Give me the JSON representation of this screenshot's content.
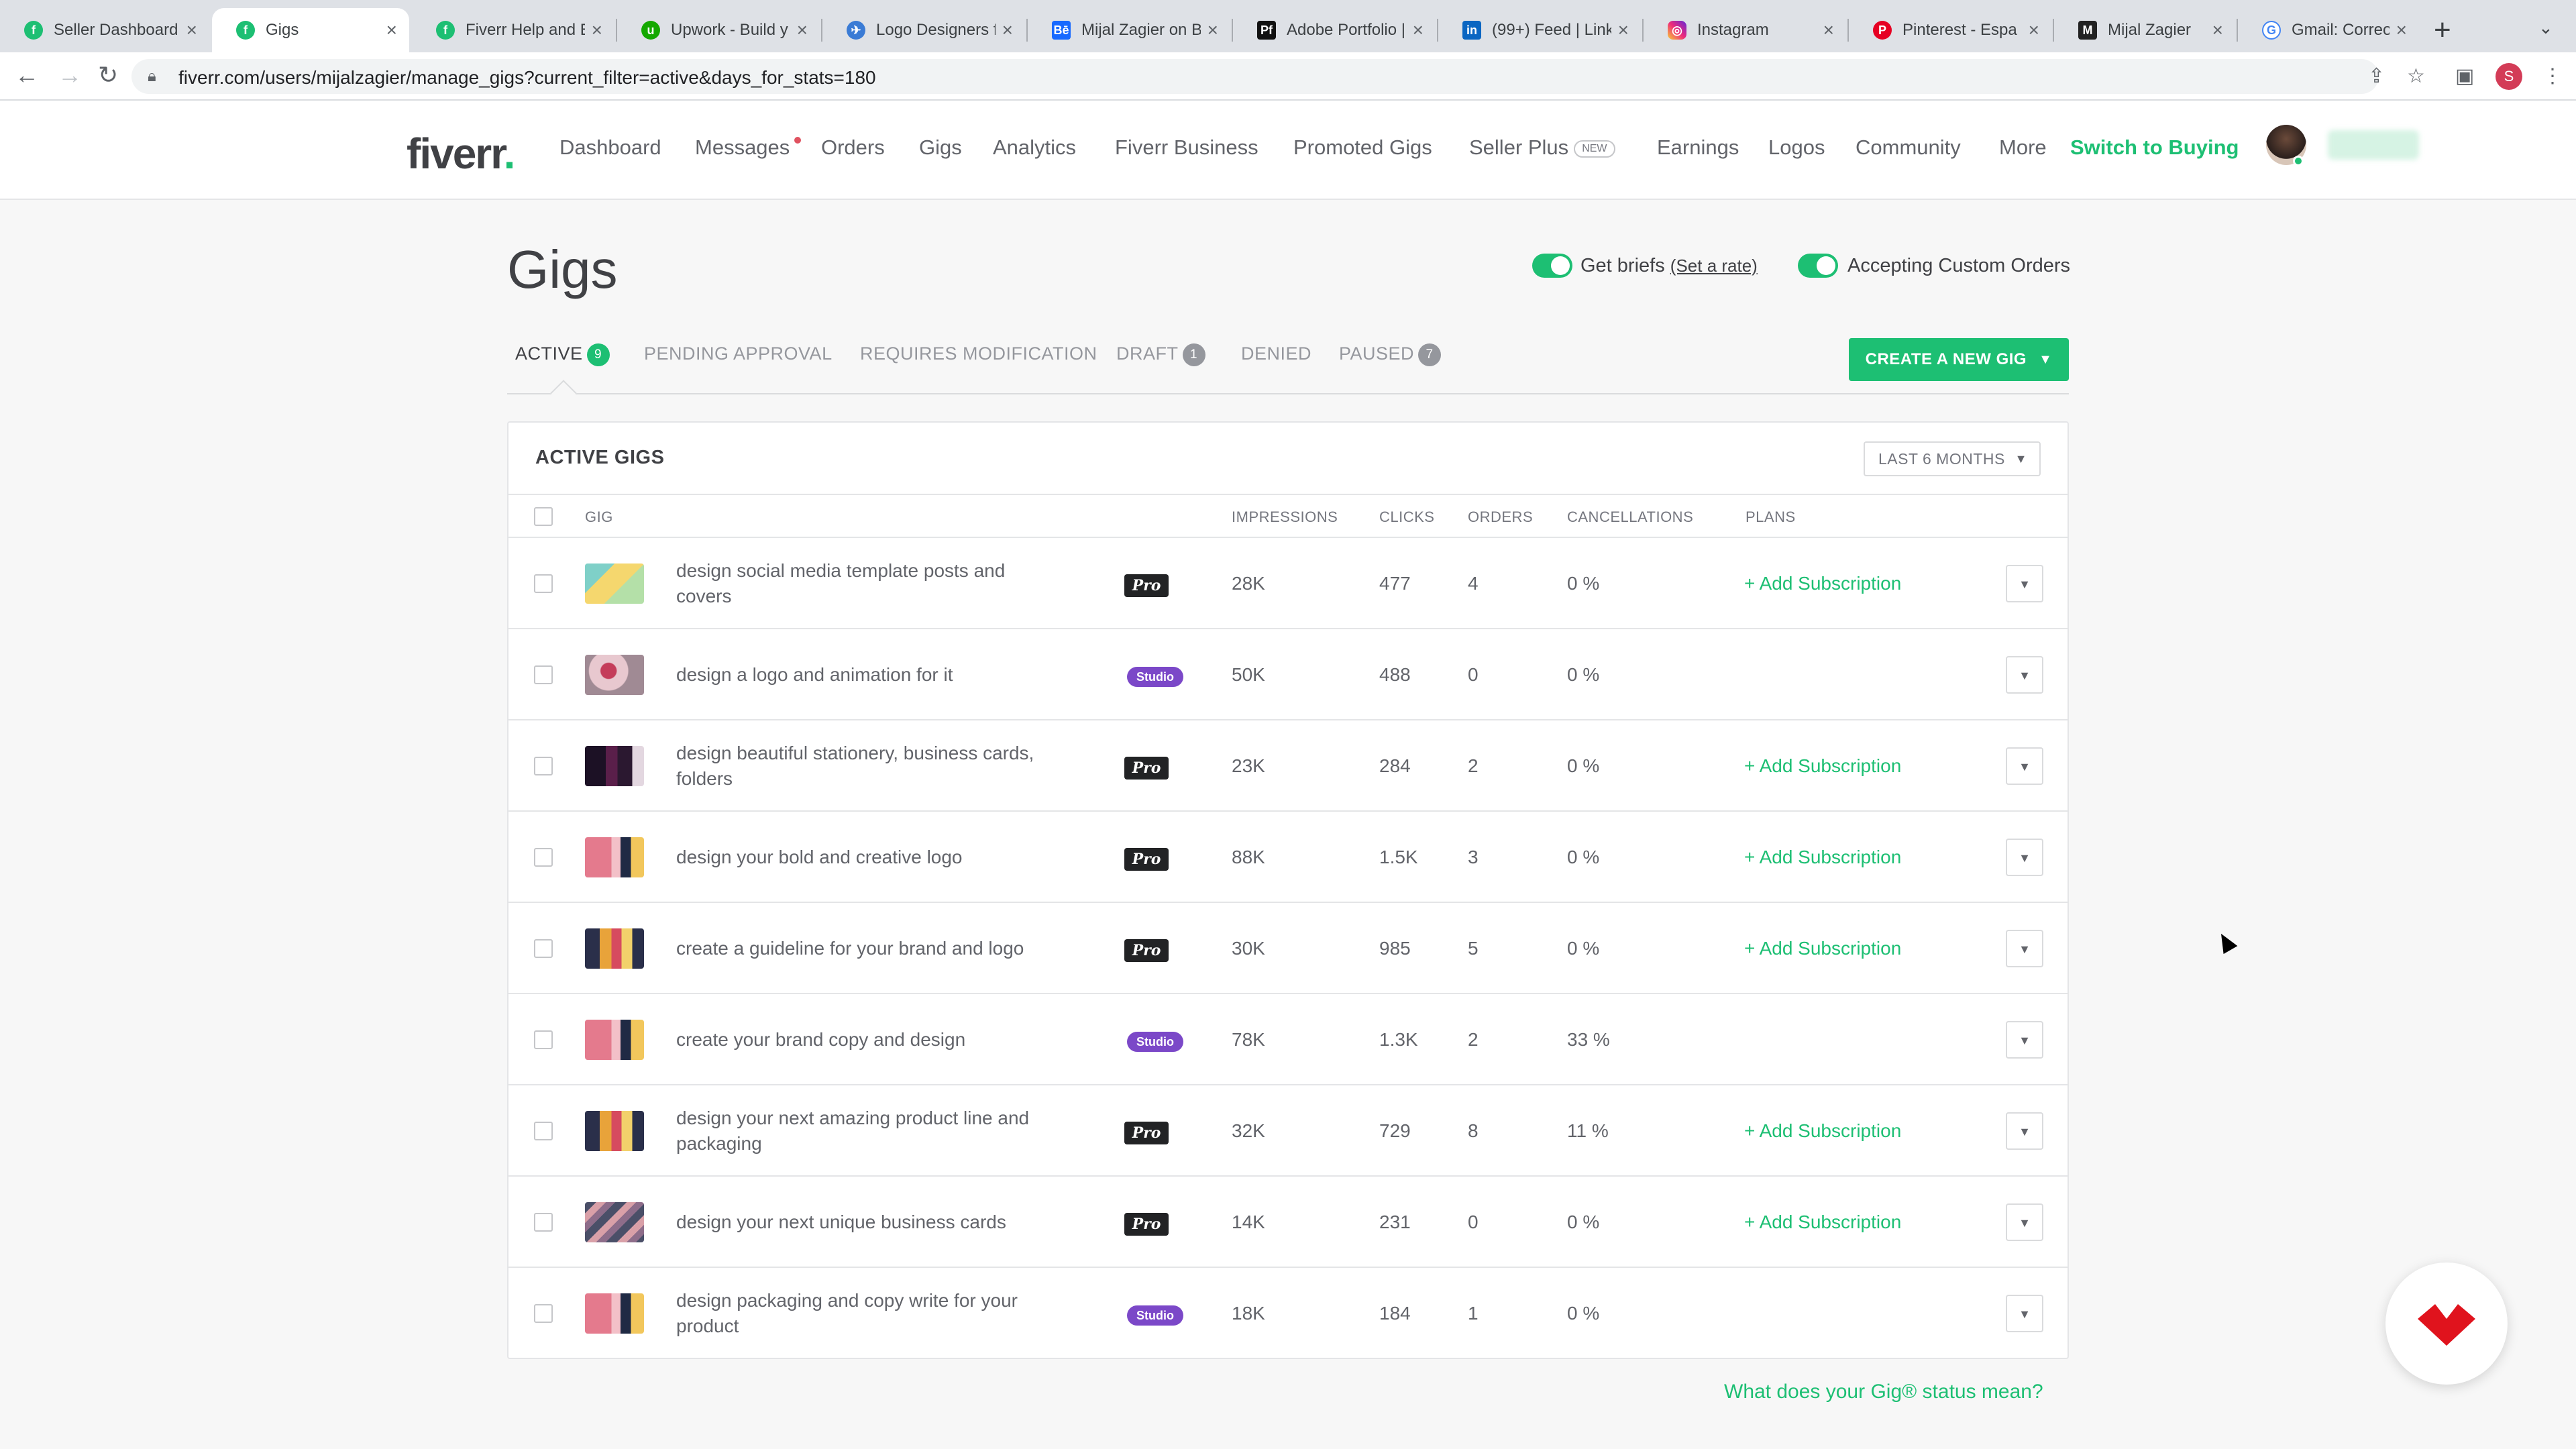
{
  "browser": {
    "tabs": [
      {
        "title": "Seller Dashboard",
        "icon": "fiverr-favicon",
        "color": "#1dbf73"
      },
      {
        "title": "Gigs",
        "icon": "fiverr-favicon",
        "color": "#1dbf73",
        "active": true
      },
      {
        "title": "Fiverr Help and E",
        "icon": "fiverr-favicon",
        "color": "#1dbf73"
      },
      {
        "title": "Upwork - Build y",
        "icon": "upwork-favicon",
        "color": "#14a800"
      },
      {
        "title": "Logo Designers f",
        "icon": "logo-designers-favicon",
        "color": "#3a7bd5"
      },
      {
        "title": "Mijal Zagier on B",
        "icon": "behance-favicon",
        "color": "#1769ff"
      },
      {
        "title": "Adobe Portfolio |",
        "icon": "adobe-portfolio-favicon",
        "color": "#111111"
      },
      {
        "title": "(99+) Feed | Link",
        "icon": "linkedin-favicon",
        "color": "#0a66c2"
      },
      {
        "title": "Instagram",
        "icon": "instagram-favicon",
        "color": "#d6249f"
      },
      {
        "title": "Pinterest - Espa",
        "icon": "pinterest-favicon",
        "color": "#e60023"
      },
      {
        "title": "Mijal Zagier",
        "icon": "website-favicon",
        "color": "#222222"
      },
      {
        "title": "Gmail: Correo ele",
        "icon": "google-favicon",
        "color": "#4285f4"
      }
    ],
    "url": "fiverr.com/users/mijalzagier/manage_gigs?current_filter=active&days_for_stats=180",
    "profile_initial": "S"
  },
  "header": {
    "logo": "fiverr",
    "logo_dot": ".",
    "nav": [
      "Dashboard",
      "Messages",
      "Orders",
      "Gigs",
      "Analytics",
      "Fiverr Business",
      "Promoted Gigs",
      "Seller Plus",
      "Earnings",
      "Logos",
      "Community",
      "More"
    ],
    "new_badge": "NEW",
    "switch_label": "Switch to Buying"
  },
  "page": {
    "title": "Gigs",
    "get_briefs_label": "Get briefs",
    "set_rate_label": "(Set a rate)",
    "custom_orders_label": "Accepting Custom Orders",
    "tabs": [
      {
        "label": "ACTIVE",
        "count": "9"
      },
      {
        "label": "PENDING APPROVAL"
      },
      {
        "label": "REQUIRES MODIFICATION"
      },
      {
        "label": "DRAFT",
        "count": "1"
      },
      {
        "label": "DENIED"
      },
      {
        "label": "PAUSED",
        "count": "7"
      }
    ],
    "create_button": "CREATE A NEW GIG",
    "status_link": "What does your Gig® status mean?"
  },
  "table": {
    "title": "ACTIVE GIGS",
    "period": "LAST 6 MONTHS",
    "headers": {
      "gig": "GIG",
      "impressions": "IMPRESSIONS",
      "clicks": "CLICKS",
      "orders": "ORDERS",
      "cancellations": "CANCELLATIONS",
      "plans": "PLANS"
    },
    "add_subscription": "+ Add Subscription",
    "rows": [
      {
        "title": "design social media template posts and covers",
        "badge": "Pro",
        "impressions": "28K",
        "clicks": "477",
        "orders": "4",
        "cancellations": "0 %",
        "plan": true
      },
      {
        "title": "design a logo and animation for it",
        "badge": "Studio",
        "impressions": "50K",
        "clicks": "488",
        "orders": "0",
        "cancellations": "0 %",
        "plan": false
      },
      {
        "title": "design beautiful stationery, business cards, folders",
        "badge": "Pro",
        "impressions": "23K",
        "clicks": "284",
        "orders": "2",
        "cancellations": "0 %",
        "plan": true
      },
      {
        "title": "design your bold and creative logo",
        "badge": "Pro",
        "impressions": "88K",
        "clicks": "1.5K",
        "orders": "3",
        "cancellations": "0 %",
        "plan": true
      },
      {
        "title": "create a guideline for your brand and logo",
        "badge": "Pro",
        "impressions": "30K",
        "clicks": "985",
        "orders": "5",
        "cancellations": "0 %",
        "plan": true
      },
      {
        "title": "create your brand copy and design",
        "badge": "Studio",
        "impressions": "78K",
        "clicks": "1.3K",
        "orders": "2",
        "cancellations": "33 %",
        "plan": false
      },
      {
        "title": "design your next amazing product line and packaging",
        "badge": "Pro",
        "impressions": "32K",
        "clicks": "729",
        "orders": "8",
        "cancellations": "11 %",
        "plan": true
      },
      {
        "title": "design your next unique business cards",
        "badge": "Pro",
        "impressions": "14K",
        "clicks": "231",
        "orders": "0",
        "cancellations": "0 %",
        "plan": true
      },
      {
        "title": "design packaging and copy write for your product",
        "badge": "Studio",
        "impressions": "18K",
        "clicks": "184",
        "orders": "1",
        "cancellations": "0 %",
        "plan": false
      }
    ]
  },
  "colors": {
    "brand_green": "#1dbf73",
    "studio_purple": "#7b48c8",
    "pro_black": "#222325"
  }
}
